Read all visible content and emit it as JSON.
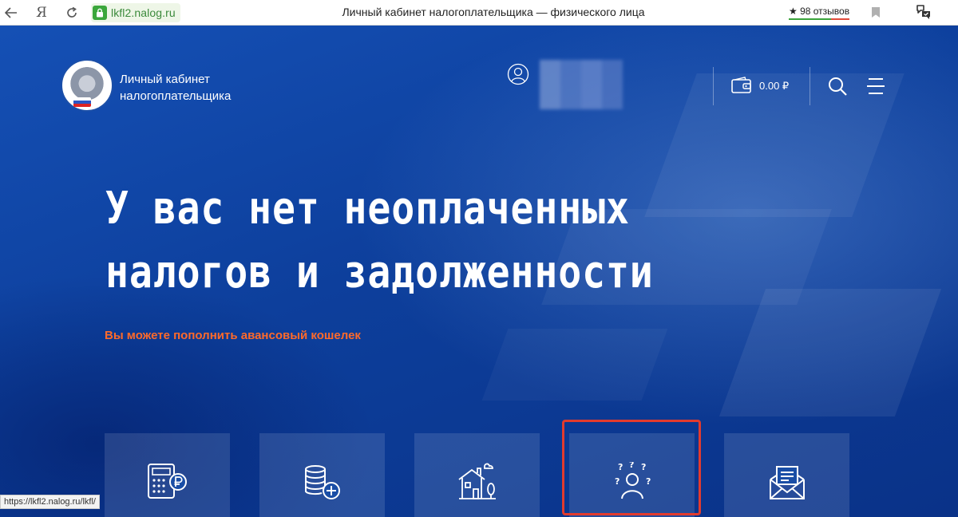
{
  "browser": {
    "url": "lkfl2.nalog.ru",
    "tab_title": "Личный кабинет налогоплательщика — физического лица",
    "yandex_letter": "Я",
    "reviews": "★ 98 отзывов"
  },
  "header": {
    "site_name_line1": "Личный кабинет",
    "site_name_line2": "налогоплательщика",
    "wallet_amount": "0.00 ₽"
  },
  "main": {
    "headline_line1": "У вас нет неоплаченных",
    "headline_line2": "налогов и задолженности",
    "topup_link": "Вы можете пополнить авансовый кошелек"
  },
  "status_bar": {
    "url": "https://lkfl2.nalog.ru/lkfl/"
  },
  "icons": {
    "tiles": [
      "calculator-ruble-icon",
      "coins-plus-icon",
      "house-property-icon",
      "person-questions-icon",
      "envelope-letter-icon"
    ]
  },
  "colors": {
    "hero_blue": "#0d3f9c",
    "link_orange": "#ff6a2a",
    "highlight_red": "#e23b2e",
    "secure_green": "#3ba73b"
  }
}
